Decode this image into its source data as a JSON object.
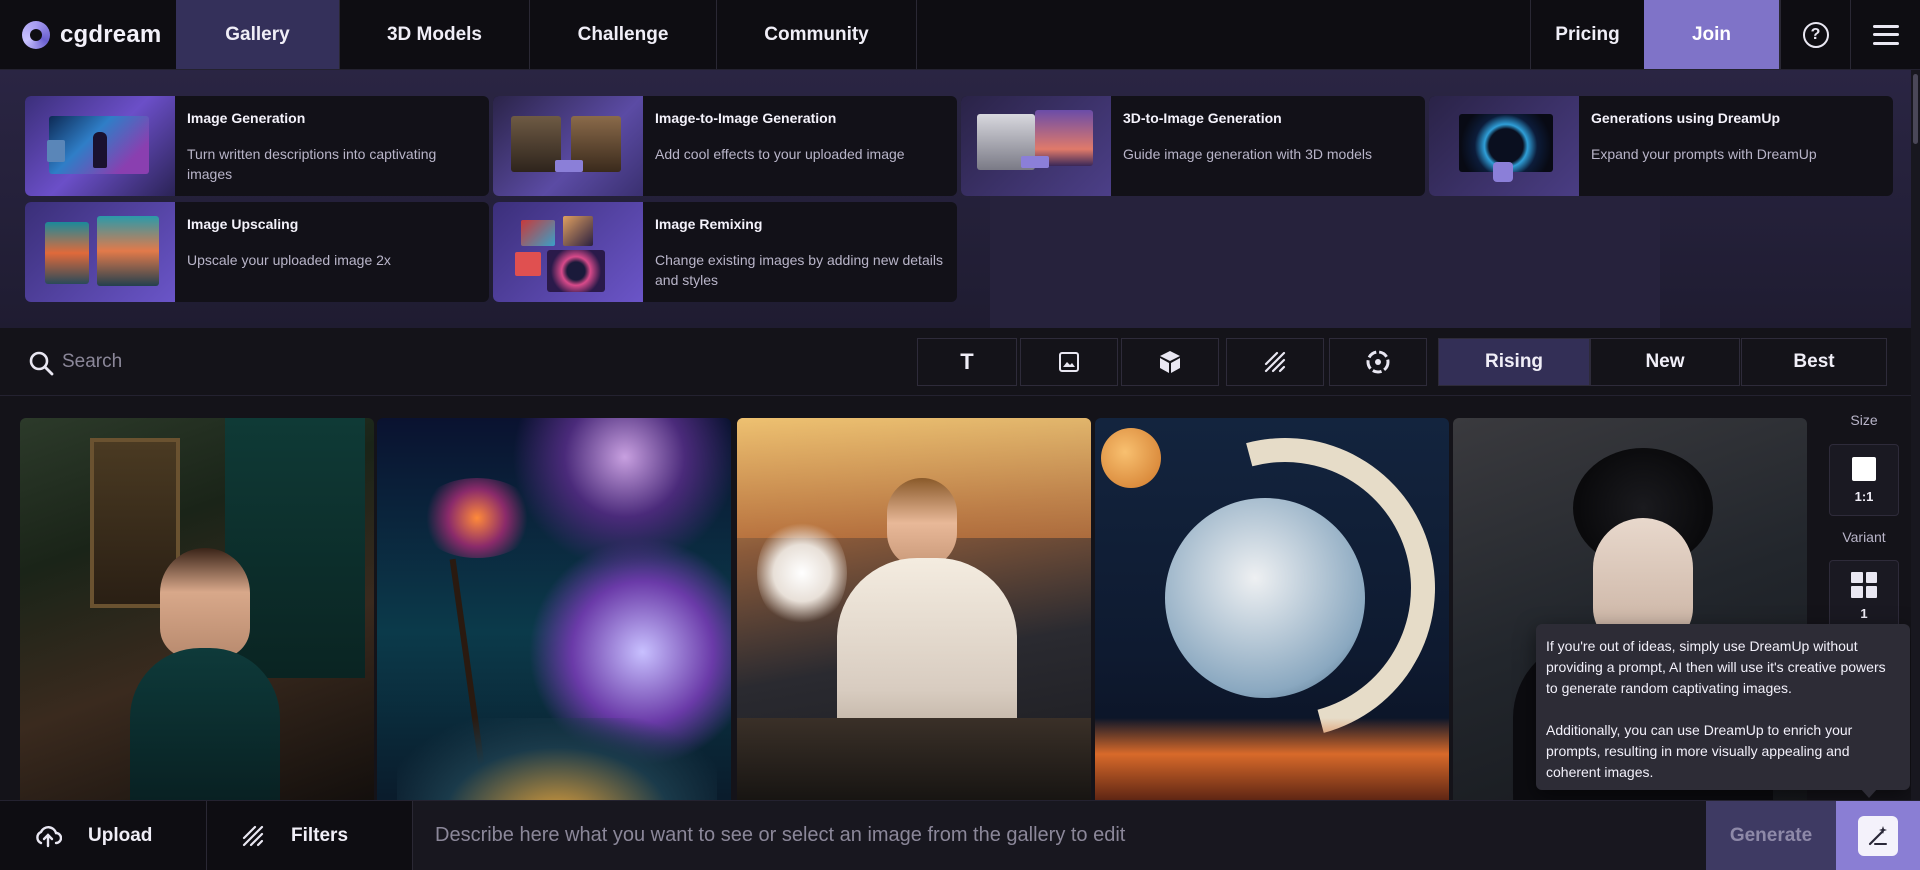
{
  "brand": {
    "name": "cgdream"
  },
  "nav": {
    "tabs": [
      "Gallery",
      "3D Models",
      "Challenge",
      "Community"
    ],
    "pricing": "Pricing",
    "join": "Join",
    "help_symbol": "?"
  },
  "tools": [
    {
      "title": "Image Generation",
      "desc": "Turn written descriptions into captivating images"
    },
    {
      "title": "Image-to-Image Generation",
      "desc": "Add cool effects to your uploaded image"
    },
    {
      "title": "3D-to-Image Generation",
      "desc": "Guide image generation with 3D models"
    },
    {
      "title": "Generations using DreamUp",
      "desc": "Expand your prompts with DreamUp"
    },
    {
      "title": "Image Upscaling",
      "desc": "Upscale your uploaded image 2x"
    },
    {
      "title": "Image Remixing",
      "desc": "Change existing images by adding new details and styles"
    }
  ],
  "search": {
    "placeholder": "Search"
  },
  "type_filters": [
    "text-icon",
    "image-icon",
    "cube-icon",
    "hatch-icon",
    "dreamup-icon"
  ],
  "sort": {
    "options": [
      "Rising",
      "New",
      "Best"
    ],
    "selected": "Rising"
  },
  "rail": {
    "size_label": "Size",
    "size_value": "1:1",
    "variant_label": "Variant",
    "variant_value": "1"
  },
  "tooltip": {
    "p1": "If you're out of ideas, simply use DreamUp without providing a prompt, AI then will use it's creative powers to generate random captivating images.",
    "p2": "Additionally, you can use DreamUp to enrich your prompts, resulting in more visually appealing and coherent images."
  },
  "bottom": {
    "upload": "Upload",
    "filters": "Filters",
    "prompt_placeholder": "Describe here what you want to see or select an image from the gallery to edit",
    "generate": "Generate"
  },
  "colors": {
    "accent": "#7f73c8",
    "active_tab": "#34305a",
    "bg": "#141319"
  }
}
